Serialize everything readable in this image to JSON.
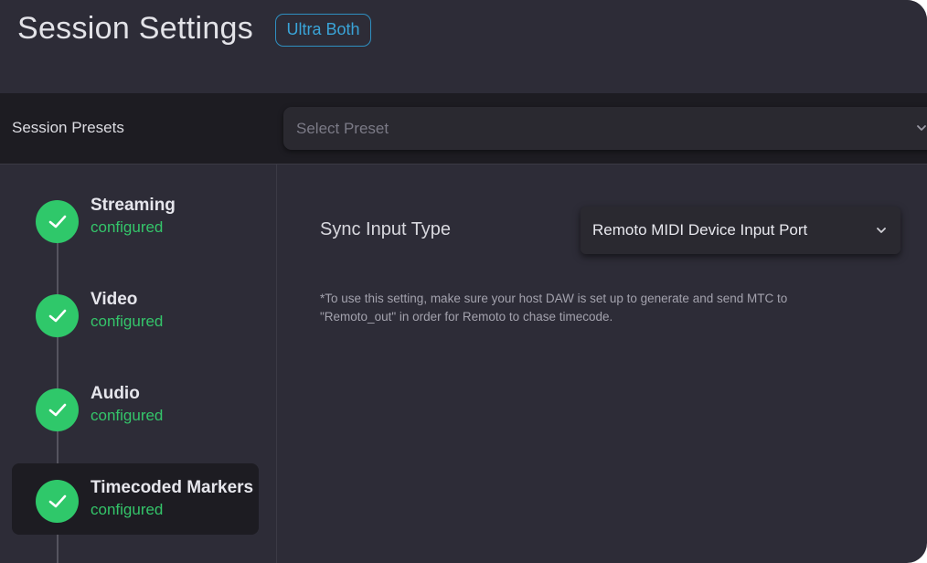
{
  "header": {
    "title": "Session Settings",
    "badge": "Ultra Both"
  },
  "presets": {
    "label": "Session Presets",
    "placeholder": "Select Preset",
    "icon": "chevron-down-icon"
  },
  "steps": [
    {
      "title": "Streaming",
      "status": "configured"
    },
    {
      "title": "Video",
      "status": "configured"
    },
    {
      "title": "Audio",
      "status": "configured"
    },
    {
      "title": "Timecoded Markers",
      "status": "configured"
    }
  ],
  "sync": {
    "label": "Sync Input Type",
    "value": "Remoto MIDI Device Input Port",
    "note_line1": "*To use this setting, make sure your host DAW is set up to generate and send MTC to",
    "note_line2": "\"Remoto_out\" in order for Remoto to chase timecode."
  },
  "colors": {
    "background": "#2d2c37",
    "bar": "#1d1c22",
    "accent_blue": "#3aa4d8",
    "check_green": "#2fc86a",
    "status_green": "#34c56a"
  }
}
